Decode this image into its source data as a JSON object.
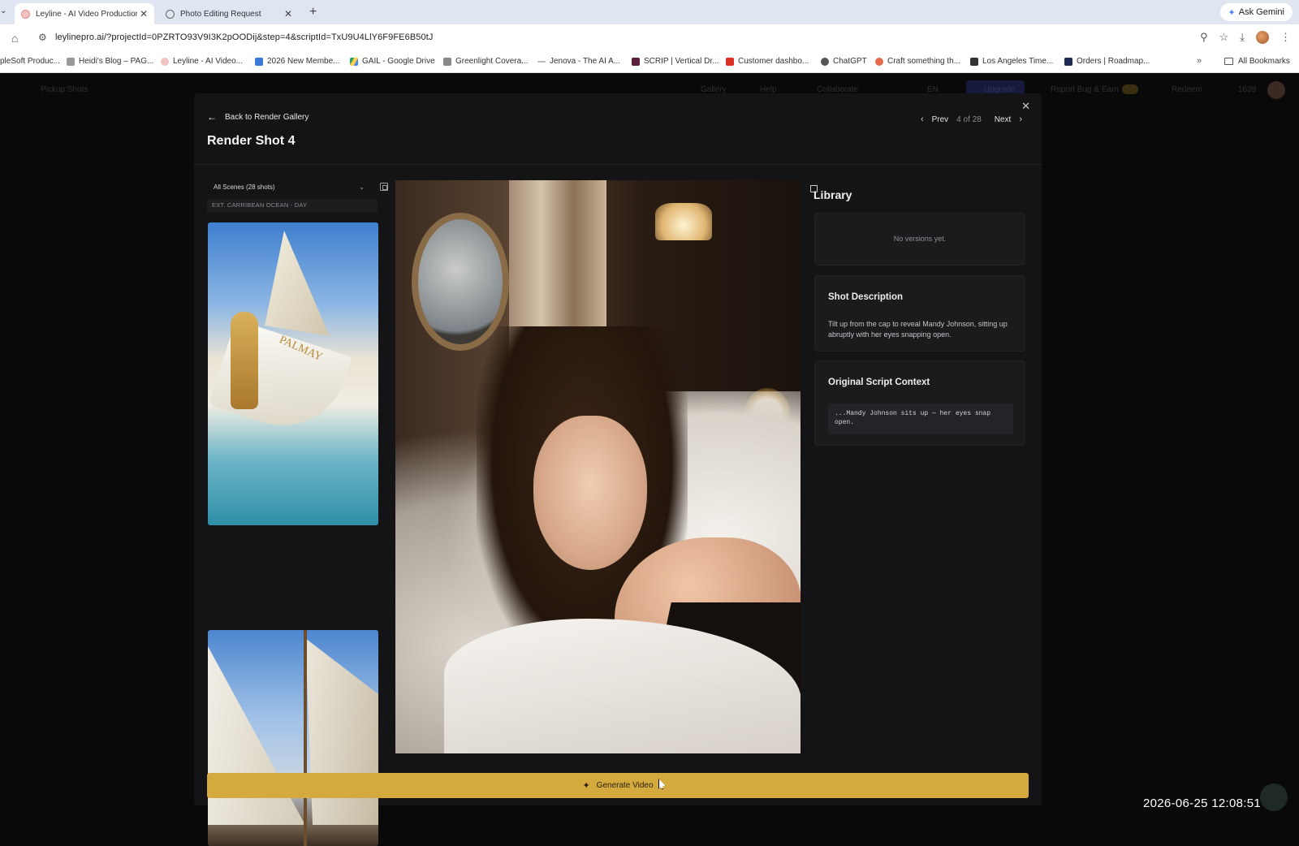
{
  "browser": {
    "tabs": [
      {
        "label": "Leyline - AI Video Production",
        "active": true
      },
      {
        "label": "Photo Editing Request",
        "active": false
      }
    ],
    "ask_gemini": "Ask Gemini",
    "url": "leylinepro.ai/?projectId=0PZRTO93V9I3K2pOODij&step=4&scriptId=TxU9U4LlY6F9FE6B50tJ",
    "bookmarks": [
      "pleSoft Produc...",
      "Heidi's Blog – PAG...",
      "Leyline - AI Video...",
      "2026 New Membe...",
      "GAIL - Google Drive",
      "Greenlight Covera...",
      "Jenova - The AI A...",
      "SCRIP | Vertical Dr...",
      "Customer dashbo...",
      "ChatGPT",
      "Craft something th...",
      "Los Angeles Time...",
      "Orders | Roadmap..."
    ],
    "all_bookmarks": "All Bookmarks"
  },
  "background_nav": {
    "left_item": "Pickup Shots",
    "items": [
      "Gallery",
      "Help",
      "Collaborate",
      "EN",
      "Upgrade",
      "Report Bug & Earn",
      "Redeem",
      "1639"
    ]
  },
  "modal": {
    "back_label": "Back to Render Gallery",
    "title": "Render Shot 4",
    "pager": {
      "prev": "Prev",
      "count": "4 of 28",
      "next": "Next"
    },
    "scene_select": "All Scenes (28 shots)",
    "scene_label": "EXT. CARRIBEAN OCEAN - DAY",
    "thumb_text": "PALMAY",
    "library": {
      "title": "Library",
      "empty_msg": "No versions yet."
    },
    "shot_description": {
      "title": "Shot Description",
      "text": "Tilt up from the cap to reveal Mandy Johnson, sitting up abruptly with her eyes snapping open."
    },
    "script_context": {
      "title": "Original Script Context",
      "text": "...Mandy Johnson sits up — her eyes snap open."
    },
    "generate_label": "Generate Video"
  },
  "overlay": {
    "timestamp": "2026-06-25 12:08:51"
  },
  "colors": {
    "accent": "#d4a93e",
    "modal_bg": "#141416",
    "card_bg": "#1b1b1e"
  }
}
